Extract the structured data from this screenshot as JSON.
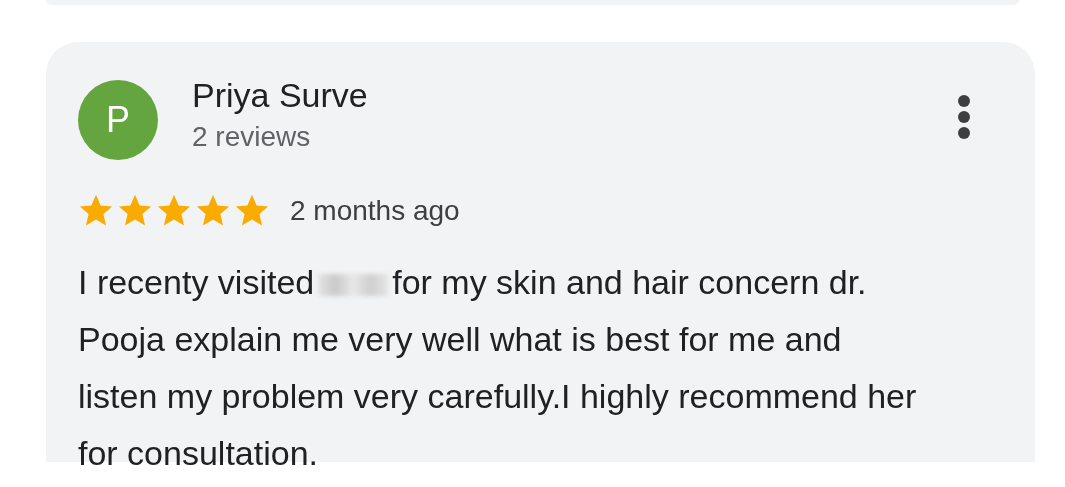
{
  "review": {
    "avatar": {
      "letter": "P",
      "color": "#65a53f"
    },
    "author": "Priya Surve",
    "meta": "2 reviews",
    "stars": 5,
    "time": "2 months ago",
    "text_parts": [
      "I recenty visited",
      "for my skin and hair concern dr. Pooja explain me very well what is best for me and listen my problem very carefully.I highly recommend her for consultation."
    ]
  }
}
